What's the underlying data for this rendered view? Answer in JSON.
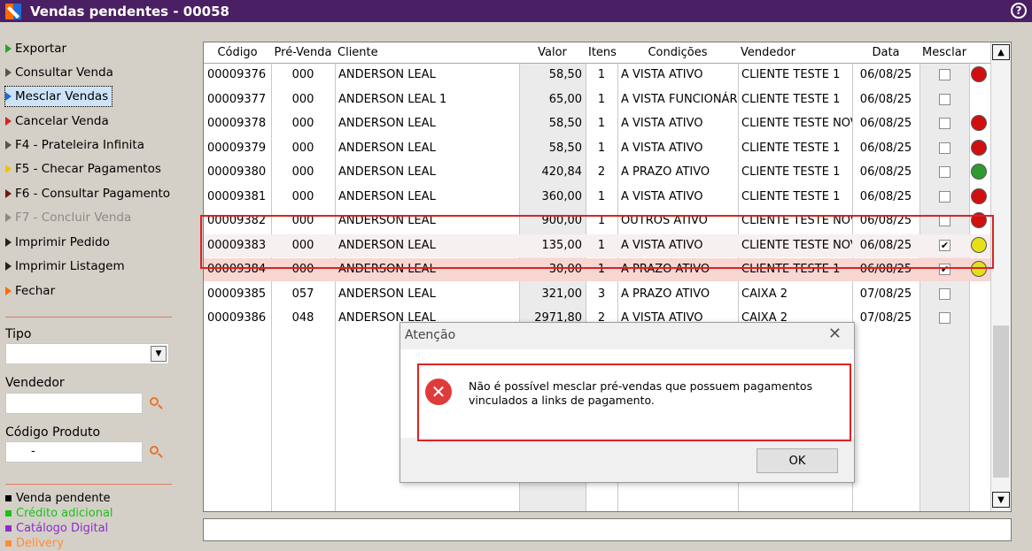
{
  "window": {
    "title": "Vendas pendentes - 00058"
  },
  "menu": [
    {
      "label": "Exportar",
      "color": "#2e9e2e",
      "disabled": false
    },
    {
      "label": "Consultar Venda",
      "color": "#555555",
      "disabled": false
    },
    {
      "label": "Mesclar Vendas",
      "color": "#1e6bd6",
      "disabled": false,
      "selected": true
    },
    {
      "label": "Cancelar Venda",
      "color": "#d62020",
      "disabled": false
    },
    {
      "label": "F4 - Prateleira Infinita",
      "color": "#555555",
      "disabled": false
    },
    {
      "label": "F5 - Checar Pagamentos",
      "color": "#f2c200",
      "disabled": false
    },
    {
      "label": "F6 - Consultar Pagamento",
      "color": "#6b1a1a",
      "disabled": false
    },
    {
      "label": "F7 - Concluir Venda",
      "color": "#8a8a8a",
      "disabled": true
    },
    {
      "label": "Imprimir Pedido",
      "color": "#222222",
      "disabled": false
    },
    {
      "label": "Imprimir Listagem",
      "color": "#222222",
      "disabled": false
    },
    {
      "label": "Fechar",
      "color": "#ff6a00",
      "disabled": false
    }
  ],
  "filters": {
    "tipo_label": "Tipo",
    "vendedor_label": "Vendedor",
    "codigo_label": "Código Produto",
    "codigo_value": "-"
  },
  "legend": [
    {
      "label": "Venda pendente",
      "color": "#000000"
    },
    {
      "label": "Crédito adicional",
      "color": "#16c316"
    },
    {
      "label": "Catálogo Digital",
      "color": "#8e2cc9"
    },
    {
      "label": "Delivery",
      "color": "#ff8c3a"
    }
  ],
  "grid": {
    "headers": [
      "Código",
      "Pré-Venda",
      "Cliente",
      "Valor",
      "Itens",
      "Condições",
      "Vendedor",
      "Data",
      "Mesclar"
    ],
    "rows": [
      {
        "codigo": "00009376",
        "prevenda": "000",
        "cliente": "ANDERSON LEAL",
        "valor": "58,50",
        "itens": "1",
        "condicoes": "A VISTA ATIVO",
        "vendedor": "CLIENTE TESTE 1",
        "data": "06/08/25",
        "checked": false,
        "status": "#d01010"
      },
      {
        "codigo": "00009377",
        "prevenda": "000",
        "cliente": "ANDERSON LEAL 1",
        "valor": "65,00",
        "itens": "1",
        "condicoes": "A VISTA FUNCIONÁRIO",
        "vendedor": "CLIENTE TESTE 1",
        "data": "06/08/25",
        "checked": false,
        "status": ""
      },
      {
        "codigo": "00009378",
        "prevenda": "000",
        "cliente": "ANDERSON LEAL",
        "valor": "58,50",
        "itens": "1",
        "condicoes": "A VISTA ATIVO",
        "vendedor": "CLIENTE TESTE NOVO",
        "data": "06/08/25",
        "checked": false,
        "status": "#d01010"
      },
      {
        "codigo": "00009379",
        "prevenda": "000",
        "cliente": "ANDERSON LEAL",
        "valor": "58,50",
        "itens": "1",
        "condicoes": "A VISTA ATIVO",
        "vendedor": "CLIENTE TESTE 1",
        "data": "06/08/25",
        "checked": false,
        "status": "#d01010"
      },
      {
        "codigo": "00009380",
        "prevenda": "000",
        "cliente": "ANDERSON LEAL",
        "valor": "420,84",
        "itens": "2",
        "condicoes": "A PRAZO ATIVO",
        "vendedor": "CLIENTE TESTE 1",
        "data": "06/08/25",
        "checked": false,
        "status": "#2f9a2f"
      },
      {
        "codigo": "00009381",
        "prevenda": "000",
        "cliente": "ANDERSON LEAL",
        "valor": "360,00",
        "itens": "1",
        "condicoes": "A VISTA ATIVO",
        "vendedor": "CLIENTE TESTE 1",
        "data": "06/08/25",
        "checked": false,
        "status": "#d01010"
      },
      {
        "codigo": "00009382",
        "prevenda": "000",
        "cliente": "ANDERSON LEAL",
        "valor": "900,00",
        "itens": "1",
        "condicoes": "OUTROS ATIVO",
        "vendedor": "CLIENTE TESTE NOVO",
        "data": "06/08/25",
        "checked": false,
        "status": "#d01010"
      },
      {
        "codigo": "00009383",
        "prevenda": "000",
        "cliente": "ANDERSON LEAL",
        "valor": "135,00",
        "itens": "1",
        "condicoes": "A VISTA ATIVO",
        "vendedor": "CLIENTE TESTE NOVO",
        "data": "06/08/25",
        "checked": true,
        "status": "#e6e01a"
      },
      {
        "codigo": "00009384",
        "prevenda": "000",
        "cliente": "ANDERSON LEAL",
        "valor": "30,00",
        "itens": "1",
        "condicoes": "A PRAZO ATIVO",
        "vendedor": "CLIENTE TESTE 1",
        "data": "06/08/25",
        "checked": true,
        "status": "#e6e01a"
      },
      {
        "codigo": "00009385",
        "prevenda": "057",
        "cliente": "ANDERSON LEAL",
        "valor": "321,00",
        "itens": "3",
        "condicoes": "A PRAZO ATIVO",
        "vendedor": "CAIXA 2",
        "data": "07/08/25",
        "checked": false,
        "status": ""
      },
      {
        "codigo": "00009386",
        "prevenda": "048",
        "cliente": "ANDERSON LEAL",
        "valor": "2971,80",
        "itens": "2",
        "condicoes": "A VISTA ATIVO",
        "vendedor": "CAIXA 2",
        "data": "07/08/25",
        "checked": false,
        "status": ""
      }
    ]
  },
  "dialog": {
    "title": "Atenção",
    "close": "✕",
    "message": "Não é possível mesclar pré-vendas que possuem pagamentos vinculados a links de pagamento.",
    "ok_label": "OK"
  }
}
